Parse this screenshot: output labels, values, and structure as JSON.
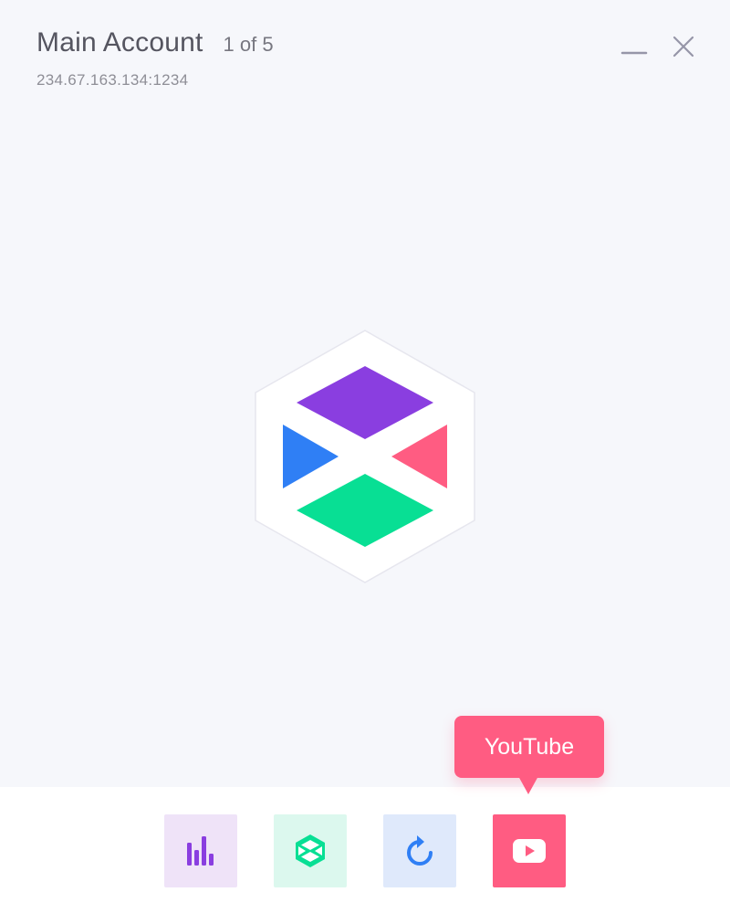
{
  "header": {
    "title": "Main Account",
    "counter": "1 of 5",
    "address": "234.67.163.134:1234"
  },
  "window_controls": {
    "minimize_icon": "minimize-icon",
    "close_icon": "close-icon"
  },
  "logo": {
    "icon": "app-logo-icon",
    "colors": {
      "top": "#8a3ee0",
      "left": "#2f7ff5",
      "right": "#ff5c82",
      "bottom": "#08df94"
    }
  },
  "toolbar": {
    "buttons": [
      {
        "name": "stats",
        "icon": "bar-chart-icon",
        "color": "#8a3ee0",
        "bg": "#efe3f8"
      },
      {
        "name": "app",
        "icon": "app-logo-icon",
        "color": "#08df94",
        "bg": "#dcf8ee"
      },
      {
        "name": "refresh",
        "icon": "refresh-icon",
        "color": "#2f7ff5",
        "bg": "#dfe9fb"
      },
      {
        "name": "youtube",
        "icon": "youtube-play-icon",
        "color": "#ffffff",
        "bg": "#ff5c82"
      }
    ]
  },
  "tooltip": {
    "label": "YouTube"
  }
}
